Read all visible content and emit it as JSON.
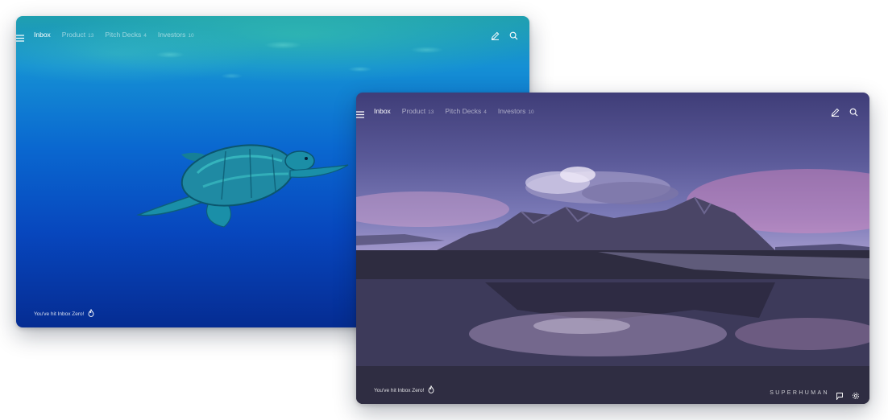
{
  "windows": [
    {
      "background": "ocean-turtle",
      "tabs": [
        {
          "label": "Inbox",
          "count": ""
        },
        {
          "label": "Product",
          "count": "13"
        },
        {
          "label": "Pitch Decks",
          "count": "4"
        },
        {
          "label": "Investors",
          "count": "10"
        }
      ],
      "footer": "You've hit Inbox Zero!"
    },
    {
      "background": "mountain-beach",
      "tabs": [
        {
          "label": "Inbox",
          "count": ""
        },
        {
          "label": "Product",
          "count": "13"
        },
        {
          "label": "Pitch Decks",
          "count": "4"
        },
        {
          "label": "Investors",
          "count": "10"
        }
      ],
      "footer": "You've hit Inbox Zero!",
      "brand": "SUPERHUMAN"
    }
  ],
  "icons": [
    "menu-icon",
    "compose-icon",
    "search-icon",
    "flame-icon",
    "feedback-icon",
    "settings-icon"
  ],
  "colors": {
    "text": "#ffffff",
    "ocean_deep": "#052c92",
    "sky_purple": "#5b5a99"
  }
}
